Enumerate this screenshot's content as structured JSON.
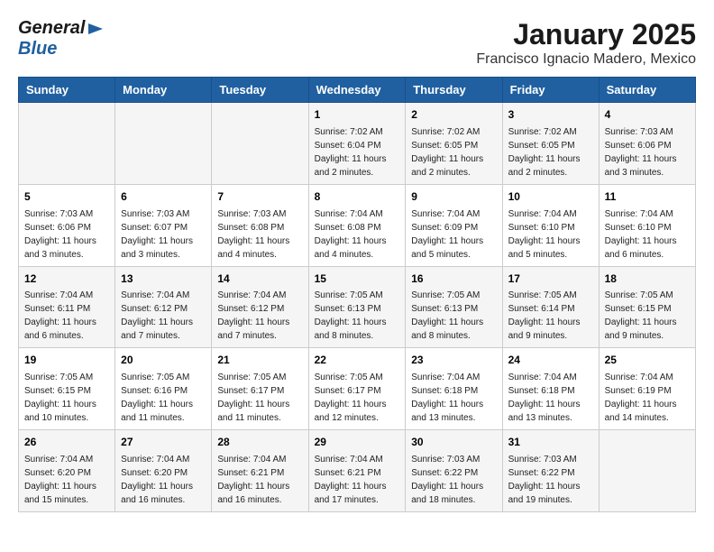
{
  "header": {
    "logo_general": "General",
    "logo_blue": "Blue",
    "month": "January 2025",
    "location": "Francisco Ignacio Madero, Mexico"
  },
  "days_of_week": [
    "Sunday",
    "Monday",
    "Tuesday",
    "Wednesday",
    "Thursday",
    "Friday",
    "Saturday"
  ],
  "weeks": [
    [
      {
        "day": "",
        "info": ""
      },
      {
        "day": "",
        "info": ""
      },
      {
        "day": "",
        "info": ""
      },
      {
        "day": "1",
        "info": "Sunrise: 7:02 AM\nSunset: 6:04 PM\nDaylight: 11 hours and 2 minutes."
      },
      {
        "day": "2",
        "info": "Sunrise: 7:02 AM\nSunset: 6:05 PM\nDaylight: 11 hours and 2 minutes."
      },
      {
        "day": "3",
        "info": "Sunrise: 7:02 AM\nSunset: 6:05 PM\nDaylight: 11 hours and 2 minutes."
      },
      {
        "day": "4",
        "info": "Sunrise: 7:03 AM\nSunset: 6:06 PM\nDaylight: 11 hours and 3 minutes."
      }
    ],
    [
      {
        "day": "5",
        "info": "Sunrise: 7:03 AM\nSunset: 6:06 PM\nDaylight: 11 hours and 3 minutes."
      },
      {
        "day": "6",
        "info": "Sunrise: 7:03 AM\nSunset: 6:07 PM\nDaylight: 11 hours and 3 minutes."
      },
      {
        "day": "7",
        "info": "Sunrise: 7:03 AM\nSunset: 6:08 PM\nDaylight: 11 hours and 4 minutes."
      },
      {
        "day": "8",
        "info": "Sunrise: 7:04 AM\nSunset: 6:08 PM\nDaylight: 11 hours and 4 minutes."
      },
      {
        "day": "9",
        "info": "Sunrise: 7:04 AM\nSunset: 6:09 PM\nDaylight: 11 hours and 5 minutes."
      },
      {
        "day": "10",
        "info": "Sunrise: 7:04 AM\nSunset: 6:10 PM\nDaylight: 11 hours and 5 minutes."
      },
      {
        "day": "11",
        "info": "Sunrise: 7:04 AM\nSunset: 6:10 PM\nDaylight: 11 hours and 6 minutes."
      }
    ],
    [
      {
        "day": "12",
        "info": "Sunrise: 7:04 AM\nSunset: 6:11 PM\nDaylight: 11 hours and 6 minutes."
      },
      {
        "day": "13",
        "info": "Sunrise: 7:04 AM\nSunset: 6:12 PM\nDaylight: 11 hours and 7 minutes."
      },
      {
        "day": "14",
        "info": "Sunrise: 7:04 AM\nSunset: 6:12 PM\nDaylight: 11 hours and 7 minutes."
      },
      {
        "day": "15",
        "info": "Sunrise: 7:05 AM\nSunset: 6:13 PM\nDaylight: 11 hours and 8 minutes."
      },
      {
        "day": "16",
        "info": "Sunrise: 7:05 AM\nSunset: 6:13 PM\nDaylight: 11 hours and 8 minutes."
      },
      {
        "day": "17",
        "info": "Sunrise: 7:05 AM\nSunset: 6:14 PM\nDaylight: 11 hours and 9 minutes."
      },
      {
        "day": "18",
        "info": "Sunrise: 7:05 AM\nSunset: 6:15 PM\nDaylight: 11 hours and 9 minutes."
      }
    ],
    [
      {
        "day": "19",
        "info": "Sunrise: 7:05 AM\nSunset: 6:15 PM\nDaylight: 11 hours and 10 minutes."
      },
      {
        "day": "20",
        "info": "Sunrise: 7:05 AM\nSunset: 6:16 PM\nDaylight: 11 hours and 11 minutes."
      },
      {
        "day": "21",
        "info": "Sunrise: 7:05 AM\nSunset: 6:17 PM\nDaylight: 11 hours and 11 minutes."
      },
      {
        "day": "22",
        "info": "Sunrise: 7:05 AM\nSunset: 6:17 PM\nDaylight: 11 hours and 12 minutes."
      },
      {
        "day": "23",
        "info": "Sunrise: 7:04 AM\nSunset: 6:18 PM\nDaylight: 11 hours and 13 minutes."
      },
      {
        "day": "24",
        "info": "Sunrise: 7:04 AM\nSunset: 6:18 PM\nDaylight: 11 hours and 13 minutes."
      },
      {
        "day": "25",
        "info": "Sunrise: 7:04 AM\nSunset: 6:19 PM\nDaylight: 11 hours and 14 minutes."
      }
    ],
    [
      {
        "day": "26",
        "info": "Sunrise: 7:04 AM\nSunset: 6:20 PM\nDaylight: 11 hours and 15 minutes."
      },
      {
        "day": "27",
        "info": "Sunrise: 7:04 AM\nSunset: 6:20 PM\nDaylight: 11 hours and 16 minutes."
      },
      {
        "day": "28",
        "info": "Sunrise: 7:04 AM\nSunset: 6:21 PM\nDaylight: 11 hours and 16 minutes."
      },
      {
        "day": "29",
        "info": "Sunrise: 7:04 AM\nSunset: 6:21 PM\nDaylight: 11 hours and 17 minutes."
      },
      {
        "day": "30",
        "info": "Sunrise: 7:03 AM\nSunset: 6:22 PM\nDaylight: 11 hours and 18 minutes."
      },
      {
        "day": "31",
        "info": "Sunrise: 7:03 AM\nSunset: 6:22 PM\nDaylight: 11 hours and 19 minutes."
      },
      {
        "day": "",
        "info": ""
      }
    ]
  ]
}
